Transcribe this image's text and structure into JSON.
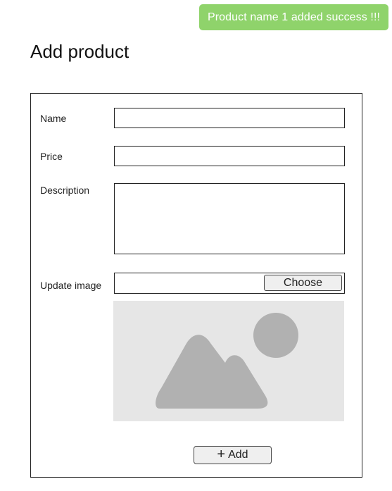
{
  "toast": {
    "message": "Product name 1 added success !!!",
    "color": "#8fd36b"
  },
  "page": {
    "title": "Add product"
  },
  "form": {
    "name": {
      "label": "Name",
      "value": ""
    },
    "price": {
      "label": "Price",
      "value": ""
    },
    "description": {
      "label": "Description",
      "value": ""
    },
    "image": {
      "label": "Update image",
      "choose_label": "Choose",
      "preview_icon": "image-placeholder-icon"
    },
    "submit": {
      "icon": "plus-icon",
      "icon_glyph": "+",
      "label": "Add"
    }
  }
}
